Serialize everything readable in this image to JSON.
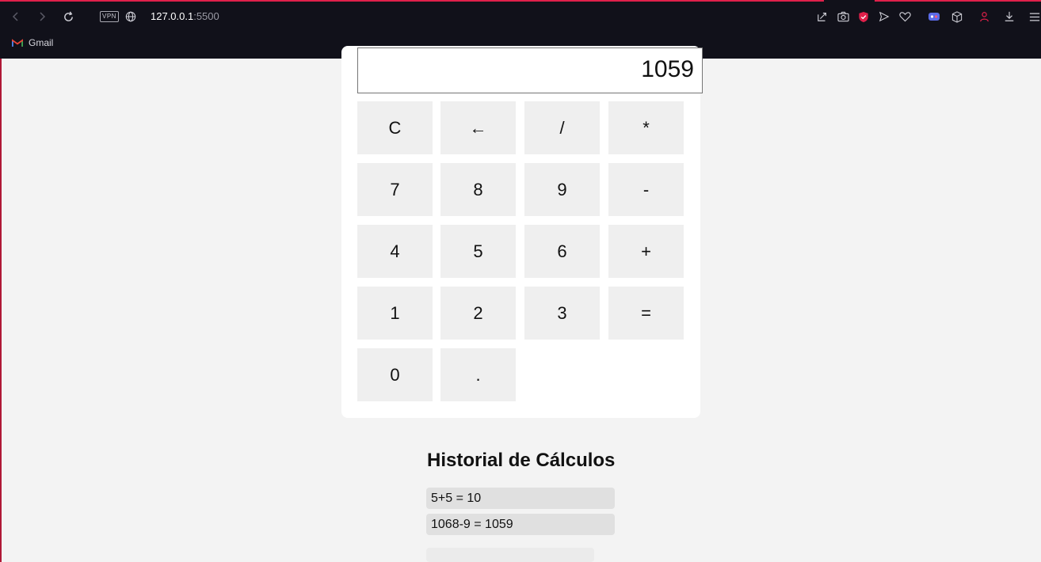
{
  "browser": {
    "url_host": "127.0.0.1",
    "url_port": ":5500",
    "vpn_label": "VPN",
    "bookmark_gmail": "Gmail",
    "accent_color": "#e0204a"
  },
  "calculator": {
    "display": "1059",
    "keys": {
      "clear": "C",
      "backspace": "←",
      "divide": "/",
      "multiply": "*",
      "seven": "7",
      "eight": "8",
      "nine": "9",
      "minus": "-",
      "four": "4",
      "five": "5",
      "six": "6",
      "plus": "+",
      "one": "1",
      "two": "2",
      "three": "3",
      "equals": "=",
      "zero": "0",
      "dot": "."
    }
  },
  "history": {
    "title": "Historial de Cálculos",
    "items": [
      "5+5 = 10",
      "1068-9 = 1059"
    ]
  }
}
